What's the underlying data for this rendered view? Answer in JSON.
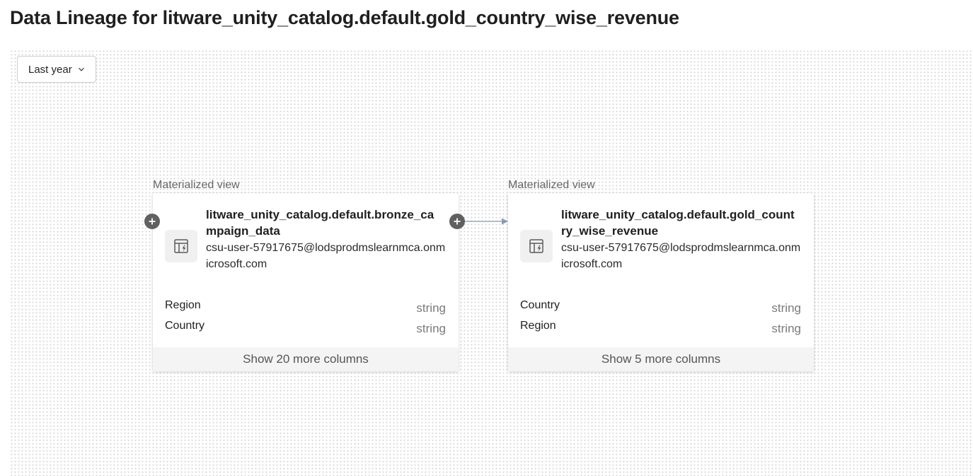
{
  "page": {
    "title": "Data Lineage for litware_unity_catalog.default.gold_country_wise_revenue"
  },
  "toolbar": {
    "time_range": "Last year"
  },
  "nodes": [
    {
      "type_label": "Materialized view",
      "name": "litware_unity_catalog.default.bronze_campaign_data",
      "owner": "csu-user-57917675@lodsprodmslearnmca.onmicrosoft.com",
      "columns": [
        {
          "name": "Region",
          "type": "string"
        },
        {
          "name": "Country",
          "type": "string"
        }
      ],
      "show_more": "Show 20 more columns"
    },
    {
      "type_label": "Materialized view",
      "name": "litware_unity_catalog.default.gold_country_wise_revenue",
      "owner": "csu-user-57917675@lodsprodmslearnmca.onmicrosoft.com",
      "columns": [
        {
          "name": "Country",
          "type": "string"
        },
        {
          "name": "Region",
          "type": "string"
        }
      ],
      "show_more": "Show 5 more columns"
    }
  ],
  "icons": {
    "time_dropdown": "chevron-down-icon",
    "node": "table-lineage-icon",
    "expand": "plus-icon"
  },
  "colors": {
    "edge": "#8a9bb0",
    "expand_button": "#606060"
  }
}
